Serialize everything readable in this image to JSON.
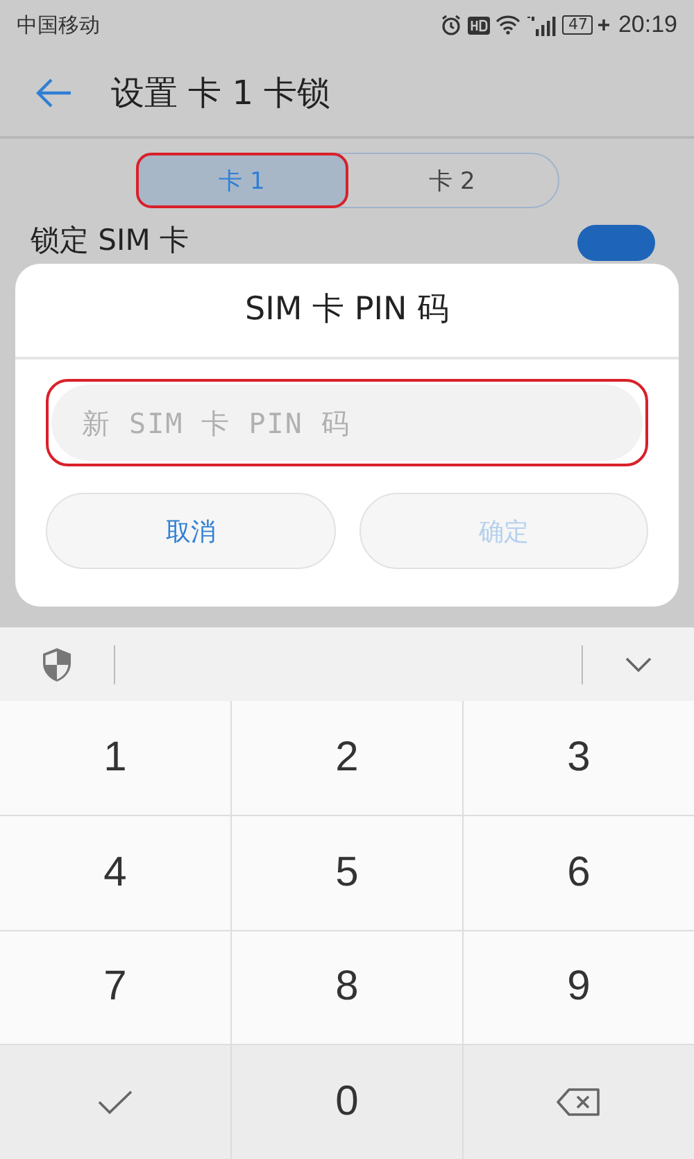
{
  "status_bar": {
    "carrier": "中国移动",
    "battery": "47",
    "time": "20:19"
  },
  "header": {
    "title": "设置 卡 1 卡锁"
  },
  "tabs": [
    {
      "label": "卡 1",
      "selected": true,
      "highlighted": true
    },
    {
      "label": "卡 2",
      "selected": false,
      "highlighted": false
    }
  ],
  "setting": {
    "label": "锁定 SIM 卡",
    "on": true
  },
  "dialog": {
    "title": "SIM 卡 PIN 码",
    "field": {
      "placeholder": "新 SIM 卡 PIN 码",
      "highlighted": true
    },
    "buttons": [
      {
        "label": "取消",
        "disabled": false
      },
      {
        "label": "确定",
        "disabled": true
      }
    ]
  },
  "keyboard": {
    "keys": [
      {
        "kind": "digit",
        "label": "1"
      },
      {
        "kind": "digit",
        "label": "2"
      },
      {
        "kind": "digit",
        "label": "3"
      },
      {
        "kind": "digit",
        "label": "4"
      },
      {
        "kind": "digit",
        "label": "5"
      },
      {
        "kind": "digit",
        "label": "6"
      },
      {
        "kind": "digit",
        "label": "7"
      },
      {
        "kind": "digit",
        "label": "8"
      },
      {
        "kind": "digit",
        "label": "9"
      },
      {
        "kind": "done"
      },
      {
        "kind": "digit",
        "label": "0"
      },
      {
        "kind": "delete"
      }
    ]
  }
}
